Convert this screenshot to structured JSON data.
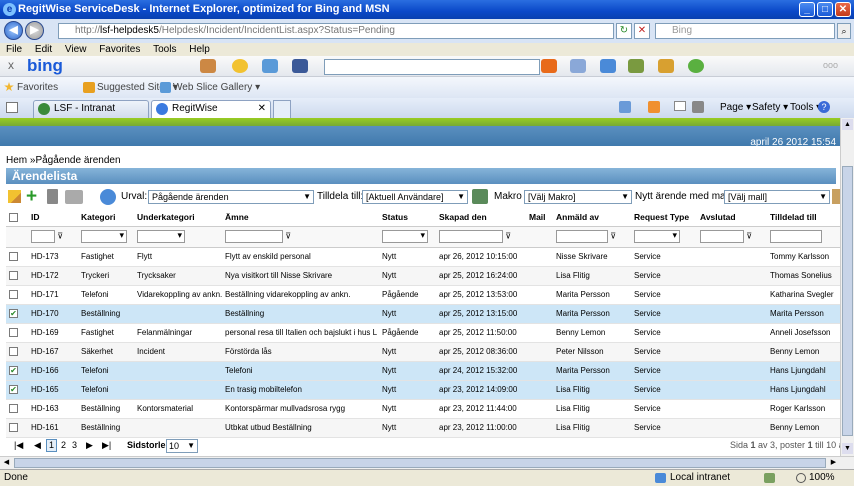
{
  "window": {
    "title": "RegitWise ServiceDesk - Internet Explorer, optimized for Bing and MSN"
  },
  "address": {
    "url_prefix": "http://",
    "url_host": "lsf-helpdesk5",
    "url_rest": "/Helpdesk/Incident/IncidentList.aspx?Status=Pending",
    "search_placeholder": "Bing"
  },
  "menu": [
    "File",
    "Edit",
    "View",
    "Favorites",
    "Tools",
    "Help"
  ],
  "bingbar": {
    "logo": "bing",
    "close": "x"
  },
  "favorites": {
    "label": "Favorites",
    "suggested": "Suggested Sites ▾",
    "webslice": "Web Slice Gallery ▾"
  },
  "tabs": [
    {
      "label": "LSF - Intranat"
    },
    {
      "label": "RegitWise ServiceDesk"
    }
  ],
  "commandbar": {
    "page": "Page ▾",
    "safety": "Safety ▾",
    "tools": "Tools ▾"
  },
  "page": {
    "date": "april 26 2012 15:54",
    "breadcrumb": "Hem »Pågående ärenden",
    "list_title": "Ärendelista",
    "urval_label": "Urval:",
    "urval_value": "Pågående ärenden",
    "tilldela_label": "Tilldela till:",
    "tilldela_value": "[Aktuell Användare]",
    "makro_label": "Makro",
    "makro_value": "[Välj Makro]",
    "nytt_label": "Nytt ärende med mall",
    "nytt_value": "[Välj mall]"
  },
  "grid": {
    "headers": [
      "ID",
      "Kategori",
      "Underkategori",
      "Ämne",
      "Status",
      "Skapad den",
      "Mail",
      "Anmäld av",
      "Request Type",
      "Avslutad",
      "Tilldelad till"
    ],
    "rows": [
      {
        "checked": false,
        "id": "HD-173",
        "kategori": "Fastighet",
        "underkategori": "Flytt",
        "amne": "Flytt av enskild personal",
        "status": "Nytt",
        "skapad": "apr 26, 2012 10:15:00",
        "anmald": "Nisse Skrivare",
        "request": "Service",
        "tilldelad": "Tommy Karlsson"
      },
      {
        "checked": false,
        "id": "HD-172",
        "kategori": "Tryckeri",
        "underkategori": "Trycksaker",
        "amne": "Nya visitkort till Nisse Skrivare",
        "status": "Nytt",
        "skapad": "apr 25, 2012 16:24:00",
        "anmald": "Lisa Flitig",
        "request": "Service",
        "tilldelad": "Thomas Sonelius"
      },
      {
        "checked": false,
        "id": "HD-171",
        "kategori": "Telefoni",
        "underkategori": "Vidarekoppling av ankn.",
        "amne": "Beställning vidarekoppling av ankn.",
        "status": "Pågående",
        "skapad": "apr 25, 2012 13:53:00",
        "anmald": "Marita Persson",
        "request": "Service",
        "tilldelad": "Katharina Svegler"
      },
      {
        "checked": true,
        "id": "HD-170",
        "kategori": "Beställning",
        "underkategori": "",
        "amne": "Beställning",
        "status": "Nytt",
        "skapad": "apr 25, 2012 13:15:00",
        "anmald": "Marita Persson",
        "request": "Service",
        "tilldelad": "Marita Persson"
      },
      {
        "checked": false,
        "id": "HD-169",
        "kategori": "Fastighet",
        "underkategori": "Felanmälningar",
        "amne": "personal resa till Italien och bajslukt i hus L",
        "status": "Pågående",
        "skapad": "apr 25, 2012 11:50:00",
        "anmald": "Benny Lemon",
        "request": "Service",
        "tilldelad": "Anneli Josefsson"
      },
      {
        "checked": false,
        "id": "HD-167",
        "kategori": "Säkerhet",
        "underkategori": "Incident",
        "amne": "Förstörda lås",
        "status": "Nytt",
        "skapad": "apr 25, 2012 08:36:00",
        "anmald": "Peter Nilsson",
        "request": "Service",
        "tilldelad": "Benny Lemon"
      },
      {
        "checked": true,
        "id": "HD-166",
        "kategori": "Telefoni",
        "underkategori": "",
        "amne": "Telefoni",
        "status": "Nytt",
        "skapad": "apr 24, 2012 15:32:00",
        "anmald": "Marita Persson",
        "request": "Service",
        "tilldelad": "Hans Ljungdahl"
      },
      {
        "checked": true,
        "id": "HD-165",
        "kategori": "Telefoni",
        "underkategori": "",
        "amne": "En trasig mobiltelefon",
        "status": "Nytt",
        "skapad": "apr 23, 2012 14:09:00",
        "anmald": "Lisa Flitig",
        "request": "Service",
        "tilldelad": "Hans Ljungdahl"
      },
      {
        "checked": false,
        "id": "HD-163",
        "kategori": "Beställning",
        "underkategori": "Kontorsmaterial",
        "amne": "Kontorspärmar mullvadsrosa rygg",
        "status": "Nytt",
        "skapad": "apr 23, 2012 11:44:00",
        "anmald": "Lisa Flitig",
        "request": "Service",
        "tilldelad": "Roger Karlsson"
      },
      {
        "checked": false,
        "id": "HD-161",
        "kategori": "Beställning",
        "underkategori": "",
        "amne": "Utbkat utbud Beställning",
        "status": "Nytt",
        "skapad": "apr 23, 2012 11:00:00",
        "anmald": "Lisa Flitig",
        "request": "Service",
        "tilldelad": "Benny Lemon"
      }
    ]
  },
  "pager": {
    "pages": [
      "1",
      "2",
      "3"
    ],
    "size_label": "Sidstorlek",
    "size_value": "10",
    "summary_prefix": "Sida ",
    "summary_current": "1",
    "summary_of": " av 3, poster ",
    "summary_range": "1",
    "summary_rest": " till 10 av 2"
  },
  "status": {
    "left": "Done",
    "zone": "Local intranet",
    "zoom": "100%"
  },
  "colors": {
    "accent": "#5a8fbf",
    "selected_row": "#cde6f7",
    "nav_green": "#7a3"
  }
}
